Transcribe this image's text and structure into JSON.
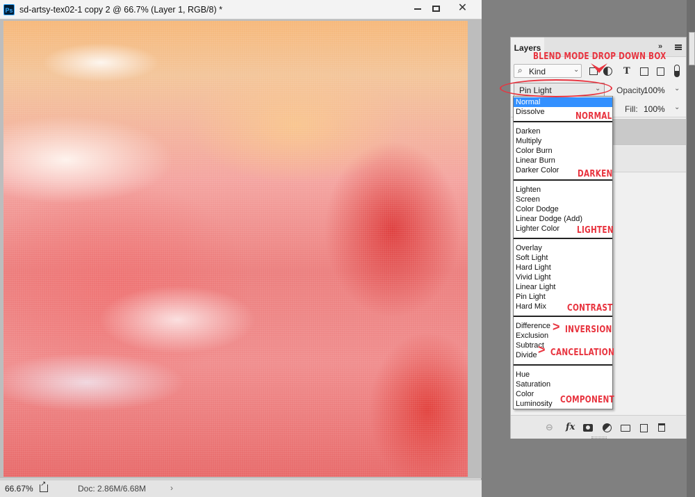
{
  "document": {
    "app_icon": "Ps",
    "title": "sd-artsy-tex02-1 copy 2 @ 66.7% (Layer 1, RGB/8) *",
    "zoom": "66.67%",
    "doc_size": "Doc: 2.86M/6.68M",
    "status_arrow": "›"
  },
  "window_controls": {
    "close": "✕"
  },
  "layers_panel": {
    "tab": "Layers",
    "collapse": "»",
    "kind_label": "Kind",
    "kind_search_icon": "⌕",
    "filter_type_icon": "T",
    "blend_mode": "Pin Light",
    "opacity_label": "Opacity:",
    "opacity_value": "100%",
    "fill_label": "Fill:",
    "fill_value": "100%",
    "chevron": "⌄",
    "footer": {
      "link_icon": "⊖",
      "fx_label": "fx"
    }
  },
  "blend_modes": [
    {
      "group": "normal",
      "items": [
        "Normal",
        "Dissolve"
      ]
    },
    {
      "group": "darken",
      "items": [
        "Darken",
        "Multiply",
        "Color Burn",
        "Linear Burn",
        "Darker Color"
      ]
    },
    {
      "group": "lighten",
      "items": [
        "Lighten",
        "Screen",
        "Color Dodge",
        "Linear Dodge (Add)",
        "Lighter Color"
      ]
    },
    {
      "group": "contrast",
      "items": [
        "Overlay",
        "Soft Light",
        "Hard Light",
        "Vivid Light",
        "Linear Light",
        "Pin Light",
        "Hard Mix"
      ]
    },
    {
      "group": "inversion-cancellation",
      "items": [
        "Difference",
        "Exclusion",
        "Subtract",
        "Divide"
      ]
    },
    {
      "group": "component",
      "items": [
        "Hue",
        "Saturation",
        "Color",
        "Luminosity"
      ]
    }
  ],
  "highlighted_mode": "Normal",
  "annotations": {
    "title": "BLEND MODE DROP DOWN BOX",
    "normal": "NORMAL",
    "darken": "DARKEN",
    "lighten": "LIGHTEN",
    "contrast": "CONTRAST",
    "inversion": "INVERSION",
    "cancellation": "CANCELLATION",
    "component": "COMPONENT",
    "arrow": ">"
  },
  "colors": {
    "annotation": "#e8343f",
    "selection": "#3390ff"
  },
  "icons": [
    "photoshop-logo-icon",
    "minimize-icon",
    "maximize-icon",
    "close-icon",
    "export-icon",
    "search-icon",
    "pixel-filter-icon",
    "adjustment-filter-icon",
    "type-filter-icon",
    "shape-filter-icon",
    "smart-object-filter-icon",
    "panel-menu-icon",
    "link-layers-icon",
    "fx-icon",
    "layer-mask-icon",
    "adjustment-layer-icon",
    "group-icon",
    "new-layer-icon",
    "trash-icon"
  ]
}
